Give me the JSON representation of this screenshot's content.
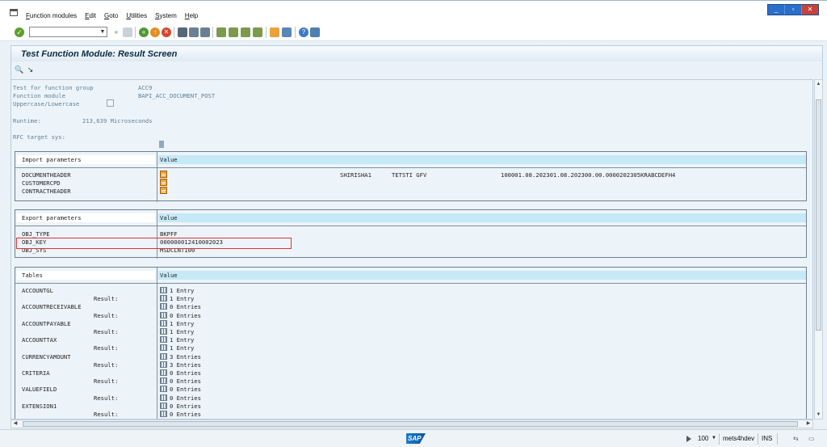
{
  "menu": {
    "items": [
      "Function modules",
      "Edit",
      "Goto",
      "Utilities",
      "System",
      "Help"
    ]
  },
  "window_controls": {
    "minimize": "_",
    "restore": "▫",
    "close": "✕"
  },
  "toolbar": {
    "command_field_value": ""
  },
  "title": "Test Function Module: Result Screen",
  "header": {
    "function_group_label": "Test for function group",
    "function_group_value": "ACC9",
    "function_module_label": "Function module",
    "function_module_value": "BAPI_ACC_DOCUMENT_POST",
    "case_label": "Uppercase/Lowercase",
    "runtime_label": "Runtime:",
    "runtime_value": "213,639 Microseconds",
    "rfc_label": "RFC target sys:"
  },
  "import_params": {
    "header_name": "Import parameters",
    "header_value": "Value",
    "rows": [
      {
        "name": "DOCUMENTHEADER",
        "v1": "SHIRISHA1",
        "v2": "TETSTI GFV",
        "v3": "100001.08.202301.08.202300.00.0000202305KRABCDEFH4"
      },
      {
        "name": "CUSTOMERCPD"
      },
      {
        "name": "CONTRACTHEADER"
      }
    ]
  },
  "export_params": {
    "header_name": "Export parameters",
    "header_value": "Value",
    "rows": [
      {
        "name": "OBJ_TYPE",
        "value": "BKPFF"
      },
      {
        "name": "OBJ_KEY",
        "value": "000000012410002023"
      },
      {
        "name": "OBJ_SYS",
        "value": "MSDCLNT100"
      }
    ]
  },
  "tables": {
    "header_name": "Tables",
    "header_value": "Value",
    "result_label": "Result:",
    "rows": [
      {
        "name": "ACCOUNTGL",
        "entries": "1 Entry",
        "result": "1 Entry"
      },
      {
        "name": "ACCOUNTRECEIVABLE",
        "entries": "0 Entries",
        "result": "0 Entries"
      },
      {
        "name": "ACCOUNTPAYABLE",
        "entries": "1 Entry",
        "result": "1 Entry"
      },
      {
        "name": "ACCOUNTTAX",
        "entries": "1 Entry",
        "result": "1 Entry"
      },
      {
        "name": "CURRENCYAMOUNT",
        "entries": "3 Entries",
        "result": "3 Entries"
      },
      {
        "name": "CRITERIA",
        "entries": "0 Entries",
        "result": "0 Entries"
      },
      {
        "name": "VALUEFIELD",
        "entries": "0 Entries",
        "result": "0 Entries"
      },
      {
        "name": "EXTENSION1",
        "entries": "0 Entries",
        "result": "0 Entries"
      }
    ]
  },
  "status": {
    "logo_text": "SAP",
    "zoom": "100",
    "server": "mets4hdev",
    "mode": "INS"
  }
}
